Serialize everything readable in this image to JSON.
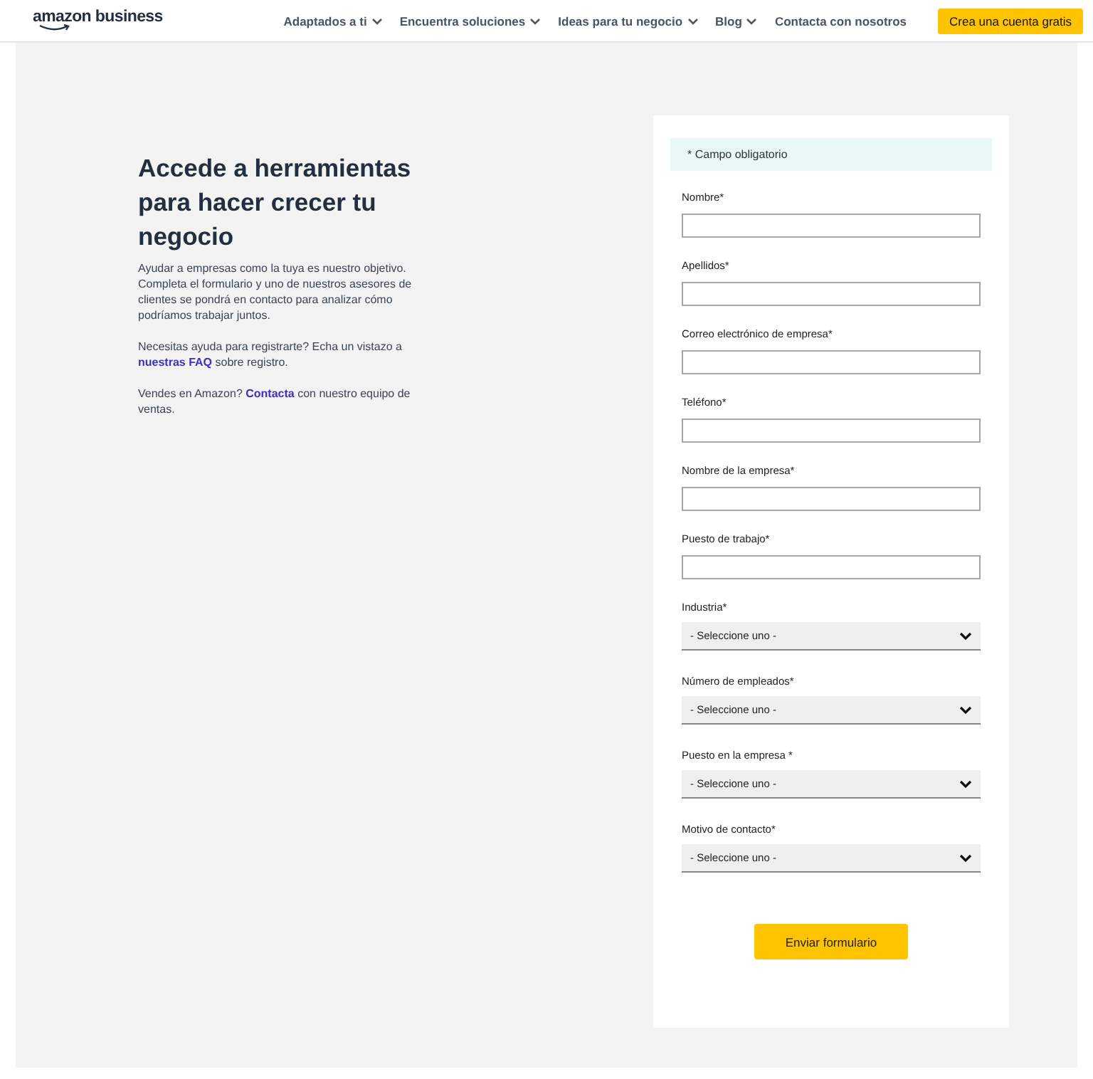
{
  "header": {
    "logo": "amazon business",
    "nav": [
      {
        "label": "Adaptados a ti",
        "has_menu": true
      },
      {
        "label": "Encuentra soluciones",
        "has_menu": true
      },
      {
        "label": "Ideas para tu negocio",
        "has_menu": true
      },
      {
        "label": "Blog",
        "has_menu": true
      },
      {
        "label": "Contacta con nosotros",
        "has_menu": false
      }
    ],
    "cta": "Crea una cuenta gratis"
  },
  "intro": {
    "heading": "Accede a herramientas para hacer crecer tu negocio",
    "paragraphs": [
      [
        {
          "kind": "text",
          "text": "Ayudar a empresas como la tuya es nuestro objetivo. Completa el formulario y uno de nuestros asesores de clientes se pondrá en contacto para analizar cómo podríamos trabajar juntos."
        }
      ],
      [
        {
          "kind": "text",
          "text": "Necesitas ayuda para registrarte? Echa un vistazo a "
        },
        {
          "kind": "link",
          "text": "nuestras FAQ"
        },
        {
          "kind": "text",
          "text": " sobre registro."
        }
      ],
      [
        {
          "kind": "text",
          "text": "Vendes en Amazon? "
        },
        {
          "kind": "link",
          "text": "Contacta"
        },
        {
          "kind": "text",
          "text": " con nuestro equipo de ventas."
        }
      ]
    ]
  },
  "form": {
    "notice": "* Campo obligatorio",
    "fields": [
      {
        "kind": "text",
        "label": "Nombre*"
      },
      {
        "kind": "text",
        "label": "Apellidos*"
      },
      {
        "kind": "text",
        "label": "Correo electrónico de empresa*"
      },
      {
        "kind": "text",
        "label": "Teléfono*"
      },
      {
        "kind": "text",
        "label": "Nombre de la empresa*"
      },
      {
        "kind": "text",
        "label": "Puesto de trabajo*"
      },
      {
        "kind": "select",
        "label": "Industria*",
        "value": "- Seleccione uno -"
      },
      {
        "kind": "select",
        "label": "Número de empleados*",
        "value": "- Seleccione uno -"
      },
      {
        "kind": "select",
        "label": "Puesto en la empresa *",
        "value": "- Seleccione uno -"
      },
      {
        "kind": "select",
        "label": "Motivo de contacto*",
        "value": "- Seleccione uno -"
      }
    ],
    "submit": "Enviar formulario"
  }
}
